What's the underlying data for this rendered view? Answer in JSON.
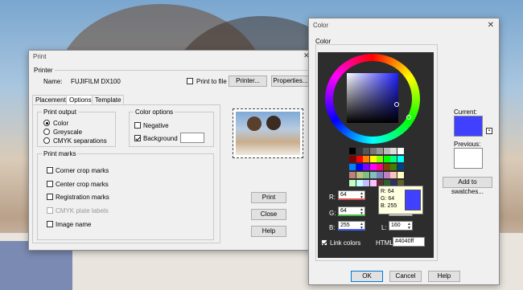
{
  "print_dialog": {
    "title": "Print",
    "printer_group": "Printer",
    "name_label": "Name:",
    "printer_name": "FUJIFILM DX100",
    "print_to_file": "Print to file",
    "printer_button": "Printer...",
    "properties_button": "Properties...",
    "tabs": [
      "Placement",
      "Options",
      "Template"
    ],
    "active_tab": "Options",
    "print_output_group": "Print output",
    "output_options": [
      "Color",
      "Greyscale",
      "CMYK separations"
    ],
    "selected_output": "Color",
    "color_options_group": "Color options",
    "negative_label": "Negative",
    "background_label": "Background",
    "print_marks_group": "Print marks",
    "marks": [
      "Corner crop marks",
      "Center crop marks",
      "Registration marks",
      "CMYK plate labels",
      "Image name"
    ],
    "print_button": "Print",
    "close_button": "Close",
    "help_button": "Help"
  },
  "color_dialog": {
    "title": "Color",
    "color_group": "Color",
    "current_label": "Current:",
    "previous_label": "Previous:",
    "add_swatches_button": "Add to swatches...",
    "r_label": "R:",
    "g_label": "G:",
    "b_label": "B:",
    "l_label": "L:",
    "r_value": "64",
    "g_value": "64",
    "b_value": "255",
    "l_value": "160",
    "tooltip_r": "R: 64",
    "tooltip_g": "G: 64",
    "tooltip_b": "B: 255",
    "link_colors_label": "Link colors",
    "html_label": "HTML:",
    "html_value": "#4040ff",
    "ok_button": "OK",
    "cancel_button": "Cancel",
    "help_button": "Help",
    "current_color": "#4040ff",
    "previous_color": "#ffffff",
    "swatch_colors": [
      "#000000",
      "#333333",
      "#555555",
      "#777777",
      "#999999",
      "#bbbbbb",
      "#dddddd",
      "#ffffff",
      "#800000",
      "#ff0000",
      "#ff8000",
      "#ffff00",
      "#80ff00",
      "#00ff00",
      "#00ff80",
      "#00ffff",
      "#0080ff",
      "#0000ff",
      "#8000ff",
      "#ff00ff",
      "#ff0080",
      "#804000",
      "#408000",
      "#004080",
      "#c08080",
      "#c0c080",
      "#80c080",
      "#80c0c0",
      "#8080c0",
      "#c080c0",
      "#ffc0c0",
      "#ffffc0",
      "#c0ffc0",
      "#c0ffff",
      "#c0c0ff",
      "#ffc0ff",
      "#603030",
      "#306030",
      "#303060",
      "#606030"
    ]
  }
}
